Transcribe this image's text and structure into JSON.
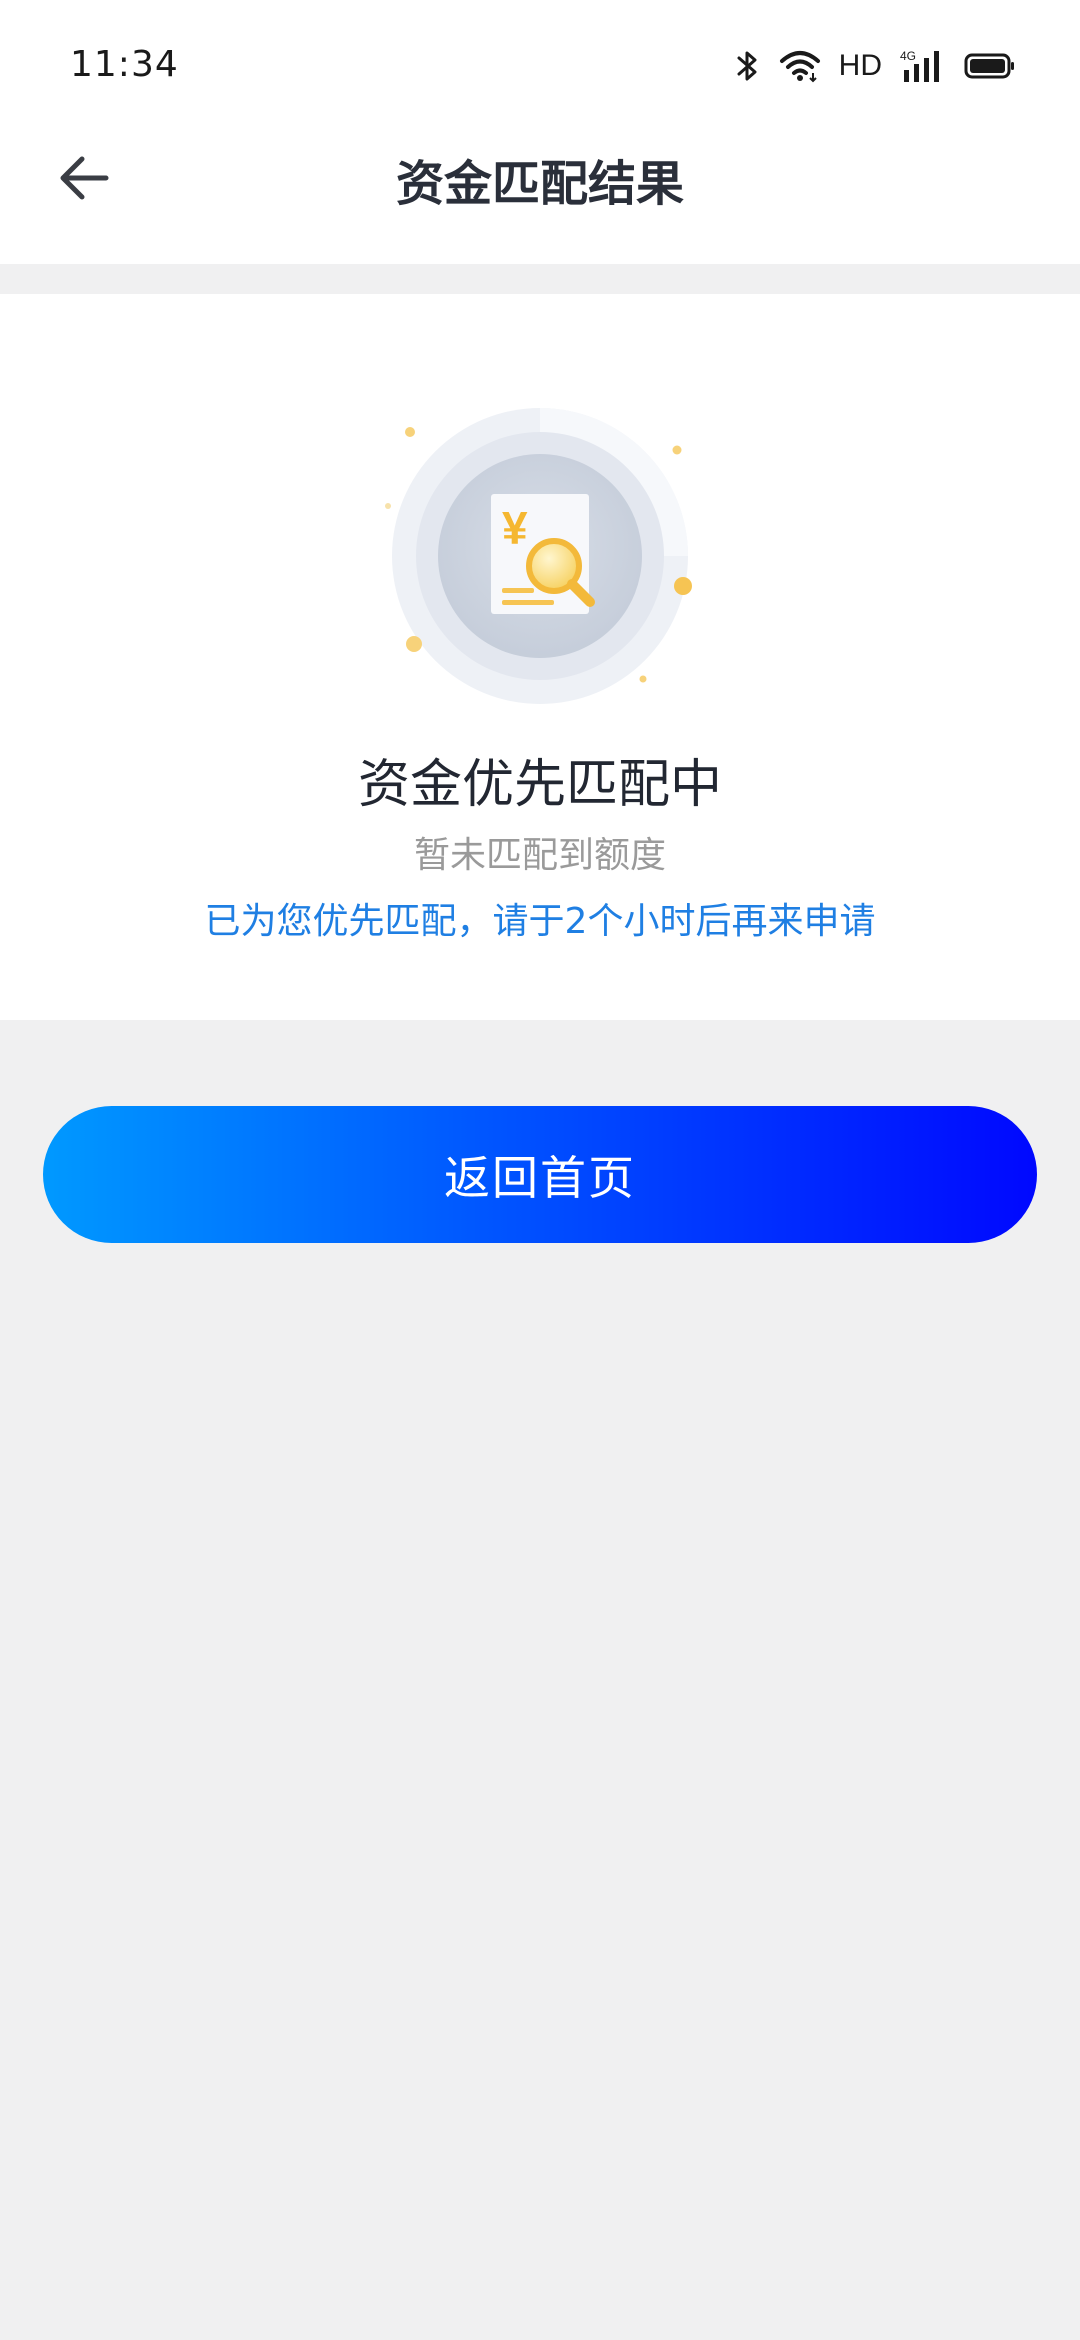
{
  "status_bar": {
    "time": "11:34",
    "network_label": "HD",
    "network_gen": "4G"
  },
  "header": {
    "title": "资金匹配结果"
  },
  "result": {
    "title": "资金优先匹配中",
    "subtitle": "暂未匹配到额度",
    "note": "已为您优先匹配，请于2个小时后再来申请",
    "illustration_symbol": "¥"
  },
  "actions": {
    "home_label": "返回首页"
  },
  "colors": {
    "accent_text": "#1f7fe3",
    "button_gradient_start": "#0099ff",
    "button_gradient_end": "#0008ff",
    "coin": "#f6c453"
  }
}
